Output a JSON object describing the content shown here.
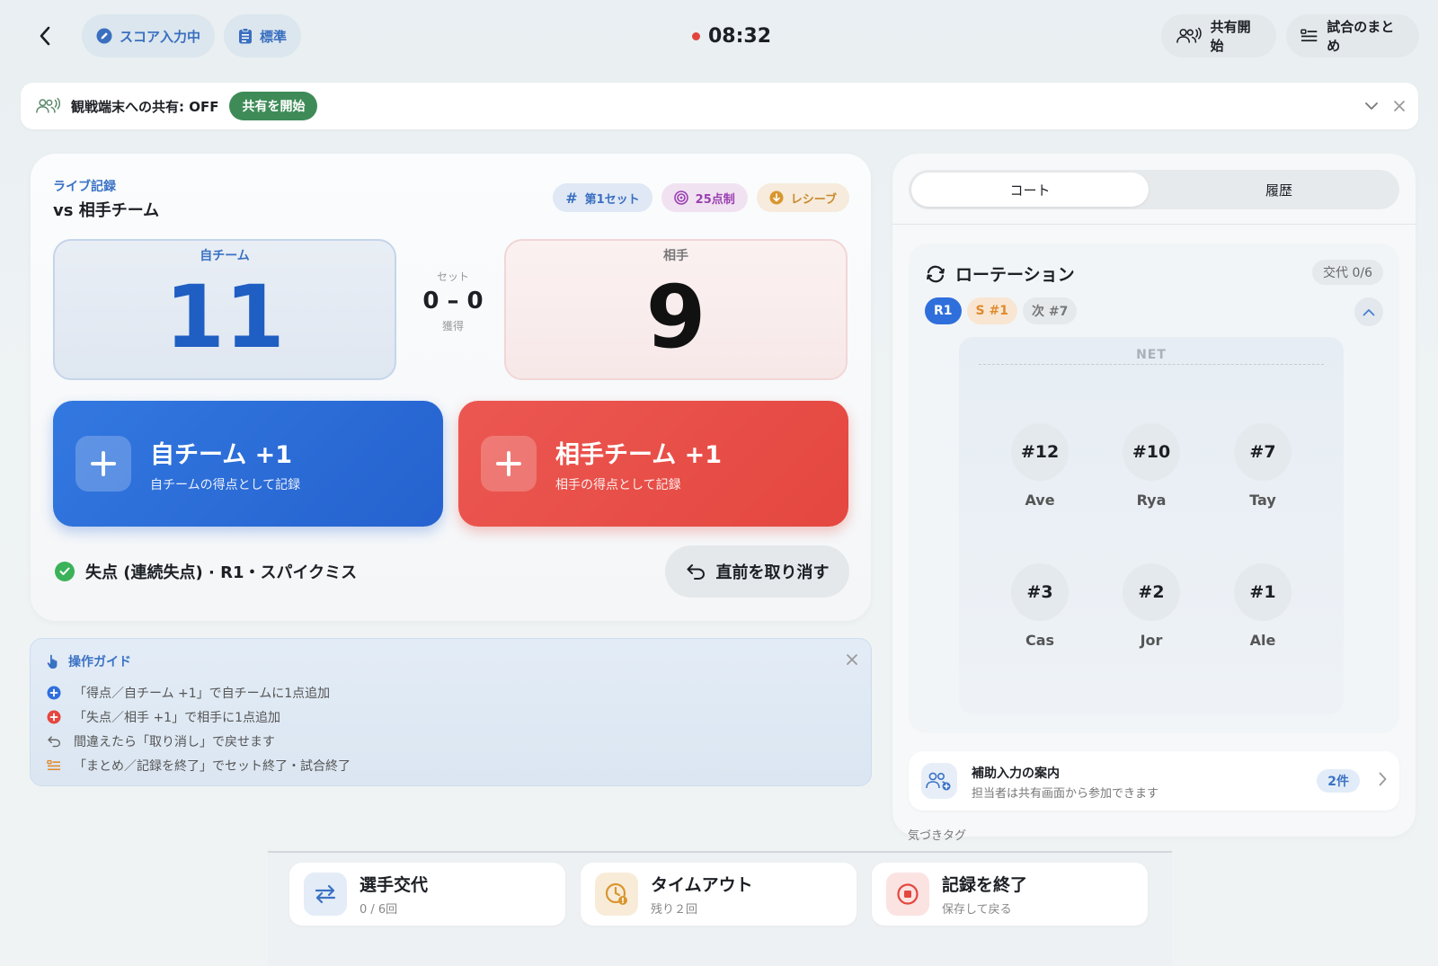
{
  "header": {
    "status_label": "スコア入力中",
    "mode_label": "標準",
    "timer": "08:32",
    "share_button": "共有開始",
    "summary_button": "試合のまとめ"
  },
  "share_banner": {
    "text": "観戦端末への共有: OFF",
    "start_button": "共有を開始"
  },
  "score": {
    "live_label": "ライブ記録",
    "vs_title": "vs 相手チーム",
    "chips": {
      "set": "第1セット",
      "points": "25点制",
      "phase": "レシーブ"
    },
    "home": {
      "label": "自チーム",
      "score": "11"
    },
    "opponent": {
      "label": "相手",
      "score": "9"
    },
    "set_info": {
      "label": "セット",
      "score": "0 – 0",
      "sub": "獲得"
    },
    "home_button": {
      "title": "自チーム +1",
      "sub": "自チームの得点として記録"
    },
    "opp_button": {
      "title": "相手チーム +1",
      "sub": "相手の得点として記録"
    },
    "last_event": "失点 (連続失点) · R1・スパイクミス",
    "undo_button": "直前を取り消す"
  },
  "guide": {
    "title": "操作ガイド",
    "items": [
      "「得点／自チーム +1」で自チームに1点追加",
      "「失点／相手 +1」で相手に1点追加",
      "間違えたら「取り消し」で戻せます",
      "「まとめ／記録を終了」でセット終了・試合終了"
    ]
  },
  "right_panel": {
    "tabs": {
      "court": "コート",
      "history": "履歴"
    },
    "rotation": {
      "title": "ローテーション",
      "subs_badge": "交代 0/6",
      "chips": {
        "rotation": "R1",
        "server": "S #1",
        "next": "次 #7"
      },
      "net_label": "NET",
      "front_row": [
        {
          "number": "#12",
          "name": "Ave"
        },
        {
          "number": "#10",
          "name": "Rya"
        },
        {
          "number": "#7",
          "name": "Tay"
        }
      ],
      "back_row": [
        {
          "number": "#3",
          "name": "Cas"
        },
        {
          "number": "#2",
          "name": "Jor"
        },
        {
          "number": "#1",
          "name": "Ale"
        }
      ]
    },
    "assist": {
      "title": "補助入力の案内",
      "sub": "担当者は共有画面から参加できます",
      "count": "2件"
    },
    "tag_label": "気づきタグ"
  },
  "bottom_bar": {
    "substitution": {
      "title": "選手交代",
      "sub": "0 / 6回"
    },
    "timeout": {
      "title": "タイムアウト",
      "sub": "残り２回"
    },
    "end": {
      "title": "記録を終了",
      "sub": "保存して戻る"
    }
  },
  "colors": {
    "accent_blue": "#2f6fdc",
    "accent_red": "#e4473f",
    "share_green": "#3e8b57",
    "check_green": "#3bb25a"
  }
}
